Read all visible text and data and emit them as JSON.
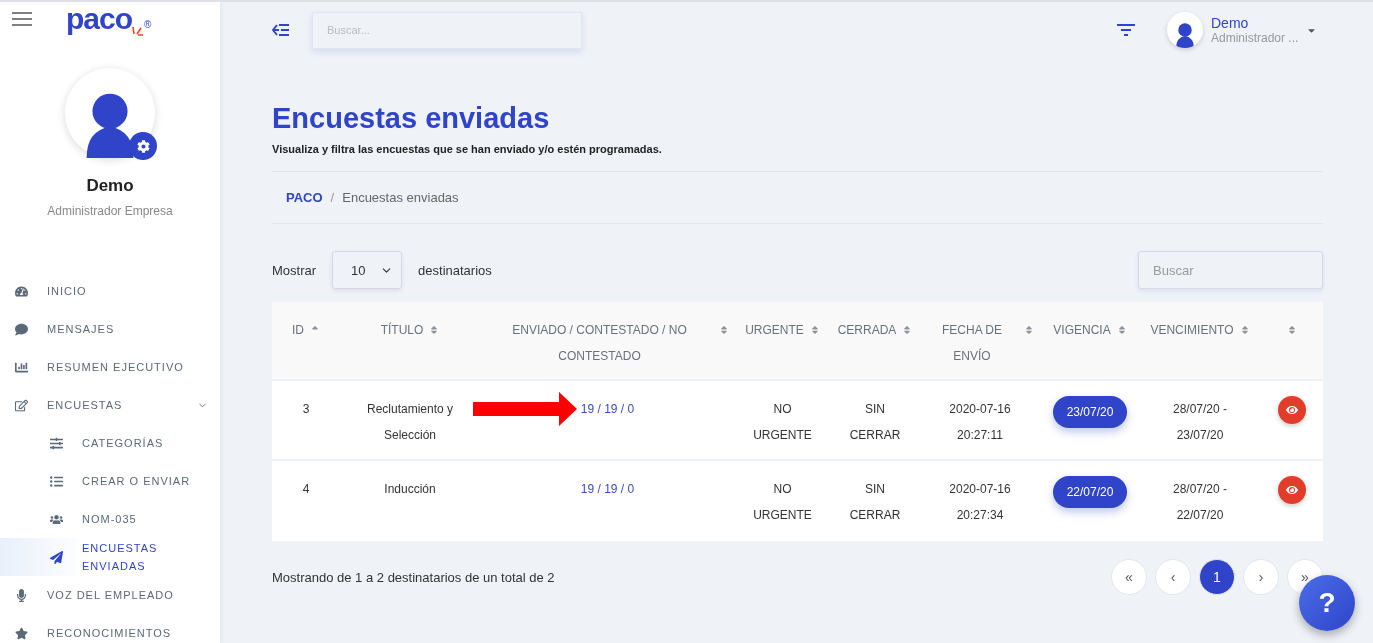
{
  "sidebar": {
    "logo": "paco",
    "logo_mark": "®",
    "user": {
      "name": "Demo",
      "role": "Administrador Empresa"
    },
    "items": [
      {
        "kind": "item",
        "label": "INICIO",
        "selected": false
      },
      {
        "kind": "item",
        "label": "MENSAJES",
        "selected": false
      },
      {
        "kind": "item",
        "label": "RESUMEN EJECUTIVO",
        "selected": false
      },
      {
        "kind": "group",
        "label": "ENCUESTAS",
        "selected": false,
        "expanded": true,
        "children": [
          {
            "kind": "item",
            "label": "CATEGORÍAS",
            "selected": false
          },
          {
            "kind": "item",
            "label": "CREAR O ENVIAR",
            "selected": false
          },
          {
            "kind": "item",
            "label": "NOM-035",
            "selected": false
          },
          {
            "kind": "item",
            "label": "ENCUESTAS ENVIADAS",
            "selected": true
          }
        ]
      },
      {
        "kind": "item",
        "label": "VOZ DEL EMPLEADO",
        "selected": false
      },
      {
        "kind": "item",
        "label": "RECONOCIMIENTOS",
        "selected": false
      }
    ]
  },
  "topbar": {
    "search": {
      "placeholder": "Buscar..."
    },
    "user": {
      "name": "Demo",
      "role": "Administrador ..."
    }
  },
  "page": {
    "title": "Encuestas enviadas",
    "subtitle": "Visualiza y filtra las encuestas que se han enviado y/o estén programadas.",
    "breadcrumb": [
      "PACO",
      "Encuestas enviadas"
    ],
    "breadcrumb_separator": "/"
  },
  "table_controls": {
    "show_label": "Mostrar",
    "page_size": "10",
    "suffix": "destinatarios",
    "search": {
      "placeholder": "Buscar"
    }
  },
  "table": {
    "columns": [
      {
        "label": "ID",
        "sorted": true
      },
      {
        "label": "TÍTULO",
        "sorted": false
      },
      {
        "label": "ENVIADO / CONTESTADO / NO CONTESTADO",
        "sorted": false
      },
      {
        "label": "URGENTE",
        "sorted": false
      },
      {
        "label": "CERRADA",
        "sorted": false
      },
      {
        "label": "FECHA DE ENVÍO",
        "sorted": false
      },
      {
        "label": "VIGENCIA",
        "sorted": false
      },
      {
        "label": "VENCIMIENTO",
        "sorted": false
      },
      {
        "sorted": false
      }
    ],
    "rows": [
      {
        "id": "3",
        "title": "Reclutamiento y Selección",
        "counts": "19 / 19 / 0",
        "urgent": "NO URGENTE",
        "closed": "SIN CERRAR",
        "sent": "2020-07-16 20:27:11",
        "validity": "23/07/20",
        "expiry": "28/07/20 - 23/07/20",
        "highlighted": true
      },
      {
        "id": "4",
        "title": "Inducción",
        "counts": "19 / 19 / 0",
        "urgent": "NO URGENTE",
        "closed": "SIN CERRAR",
        "sent": "2020-07-16 20:27:34",
        "validity": "22/07/20",
        "expiry": "28/07/20 - 22/07/20",
        "highlighted": false
      }
    ]
  },
  "footer": {
    "summary": "Mostrando de 1 a 2 destinatarios de un total de 2",
    "pagination": [
      {
        "label": "«",
        "selected": false
      },
      {
        "label": "‹",
        "selected": false
      },
      {
        "label": "1",
        "selected": true
      },
      {
        "label": "›",
        "selected": false
      },
      {
        "label": "»",
        "selected": false
      }
    ]
  },
  "help_button": {
    "label": "?"
  }
}
